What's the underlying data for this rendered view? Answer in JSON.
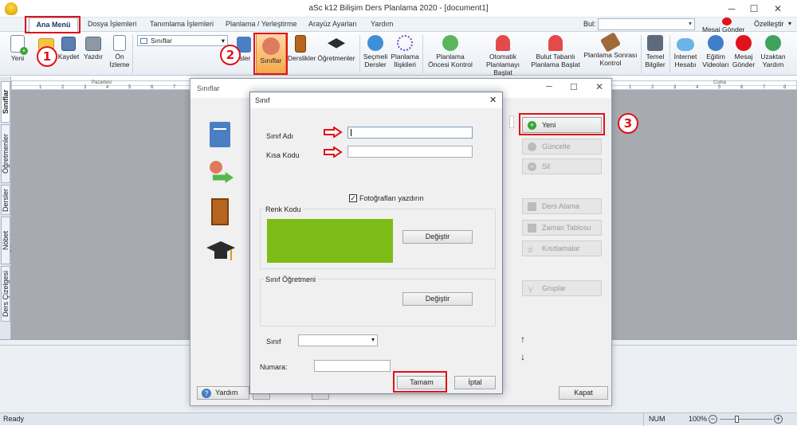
{
  "window": {
    "title": "aSc k12 Bilişim Ders Planlama 2020  - [document1]",
    "minimize": "─",
    "maximize": "☐",
    "close": "✕"
  },
  "menu": {
    "tabs": [
      "Ana Menü",
      "Dosya İşlemleri",
      "Tanımlama İşlemleri",
      "Planlama / Yerleştirme",
      "Arayüz Ayarları",
      "Yardım"
    ],
    "find_label": "Bul:",
    "customize": "Özelleştir",
    "send_message": "Mesaj Gönder"
  },
  "ribbon": {
    "new": "Yeni",
    "save": "Kaydet",
    "print": "Yazdır",
    "preview": "Ön İzleme",
    "view_select": "Sınıflar",
    "lessons_partial": "rsler",
    "classes": "Sınıflar",
    "classrooms": "Derslikler",
    "teachers": "Öğretmenler",
    "elective": "Seçmeli Dersler",
    "relations": "Planlama İlişkileri",
    "precheck": "Planlama Öncesi Kontrol",
    "auto_start": "Otomatik Planlamayı Başlat",
    "cloud_start": "Bulut Tabanlı Planlama Başlat",
    "postcheck": "Planlama Sonrası Kontrol",
    "basic_info": "Temel Bilgiler",
    "internet": "İnternet Hesabı",
    "videos": "Eğitim Videoları",
    "message": "Mesaj Gönder",
    "remote": "Uzaktan Yardım"
  },
  "ruler": {
    "left_day": "Pazartesi",
    "right_day": "Cuma",
    "left_ticks": [
      "1",
      "2",
      "3",
      "4",
      "5",
      "6",
      "7",
      "8"
    ],
    "right_ticks": [
      "1",
      "2",
      "3",
      "4",
      "5",
      "6",
      "7",
      "8"
    ]
  },
  "sidebar_tabs": [
    "Sınıflar",
    "Öğretmenler",
    "Dersler",
    "Nöbet Gözetim",
    "Ders Çizelgesi"
  ],
  "status": {
    "left": "Ready",
    "num": "NUM",
    "zoom": "100%"
  },
  "classes_window": {
    "title": "Sınıflar",
    "buttons": {
      "new": "Yeni",
      "update": "Güncelle",
      "delete": "Sil",
      "assign": "Ders Atama",
      "timetable": "Zaman Tablosu",
      "constraints": "Kısıtlamalar",
      "groups": "Gruplar"
    },
    "help": "Yardım",
    "close_btn": "Kapat",
    "up": "↑",
    "down": "↓"
  },
  "class_dialog": {
    "title": "Sınıf",
    "name_label": "Sınıf Adı",
    "name_value": "",
    "short_label": "Kısa Kodu",
    "short_value": "",
    "print_photos": "Fotoğrafları yazdırın",
    "print_photos_checked": true,
    "color_group": "Renk Kodu",
    "color_value": "#7dbb17",
    "change_btn": "Değiştir",
    "teacher_group": "Sınıf Öğretmeni",
    "change_btn2": "Değiştir",
    "class_label": "Sınıf",
    "number_label": "Numara:",
    "ok": "Tamam",
    "cancel": "İptal"
  },
  "annotations": {
    "step1": "1",
    "step2": "2",
    "step3": "3",
    "accent": "#e0121b"
  }
}
